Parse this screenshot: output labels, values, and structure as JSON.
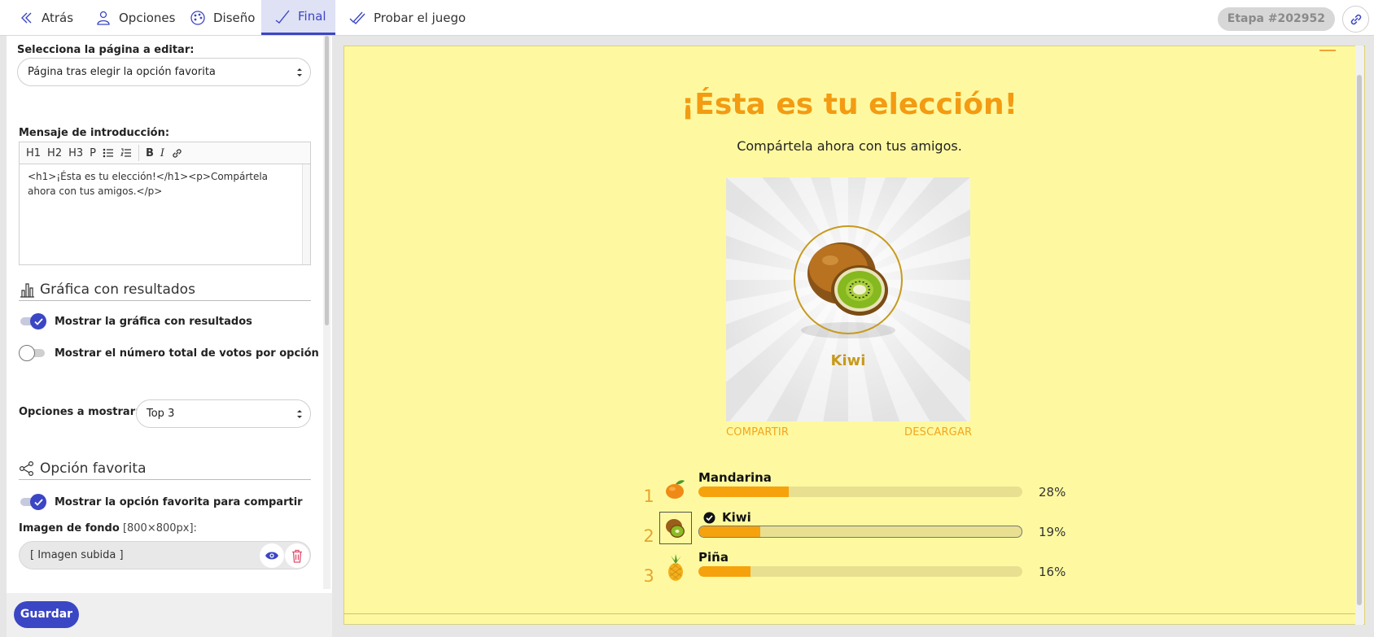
{
  "topbar": {
    "tabs": [
      {
        "label": "Atrás",
        "icon": "chevron-left-icon"
      },
      {
        "label": "Opciones",
        "icon": "user-icon"
      },
      {
        "label": "Diseño",
        "icon": "palette-icon"
      },
      {
        "label": "Final",
        "icon": "check-icon",
        "active": true
      },
      {
        "label": "Probar el juego",
        "icon": "double-check-icon"
      }
    ],
    "stage_badge": "Etapa #202952",
    "link_icon": "link-icon"
  },
  "left": {
    "page_select": {
      "label": "Selecciona la página a editar:",
      "value": "Página tras elegir la opción favorita"
    },
    "intro": {
      "label": "Mensaje de introducción:",
      "toolbar": [
        "H1",
        "H2",
        "H3",
        "P",
        "bullet-list-icon",
        "numbered-list-icon",
        "B",
        "I",
        "link-icon"
      ],
      "content": "<h1>¡Ésta es tu elección!</h1><p>Compártela ahora con tus amigos.</p>"
    },
    "results_section": {
      "title": "Gráfica con resultados",
      "show_chart": {
        "label": "Mostrar la gráfica con resultados",
        "on": true
      },
      "show_votes": {
        "label": "Mostrar el número total de votos por opción",
        "on": false
      },
      "options_to_show": {
        "label": "Opciones a mostrar:",
        "value": "Top 3"
      }
    },
    "favorite_section": {
      "title": "Opción favorita",
      "show_favorite": {
        "label": "Mostrar la opción favorita para compartir",
        "on": true
      },
      "bg_image": {
        "label": "Imagen de fondo",
        "hint": "[800×800px]:",
        "value": "[ Imagen subida ]"
      }
    },
    "save_label": "Guardar"
  },
  "preview": {
    "headline": "¡Ésta es tu elección!",
    "subline": "Compártela ahora con tus amigos.",
    "card": {
      "name": "Kiwi",
      "share": "COMPARTIR",
      "download": "DESCARGAR"
    },
    "results": [
      {
        "rank": "1",
        "name": "Mandarina",
        "percent": 28,
        "percent_label": "28%",
        "selected": false
      },
      {
        "rank": "2",
        "name": "Kiwi",
        "percent": 19,
        "percent_label": "19%",
        "selected": true
      },
      {
        "rank": "3",
        "name": "Piña",
        "percent": 16,
        "percent_label": "16%",
        "selected": false
      }
    ],
    "colors": {
      "accent": "#f39b12",
      "background": "#fef9a0",
      "bar_fill": "#f6a20d",
      "primary": "#3b46c4"
    }
  }
}
